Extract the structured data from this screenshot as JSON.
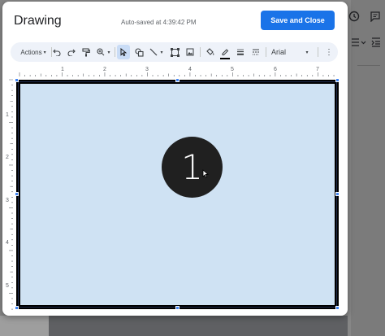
{
  "dialog": {
    "title": "Drawing",
    "autosave": "Auto-saved at 4:39:42 PM",
    "save_label": "Save and Close"
  },
  "toolbar": {
    "actions_label": "Actions",
    "actions_caret": "▾",
    "zoom_caret": "▾",
    "line_caret": "▾",
    "font_value": "Arial",
    "font_caret": "▾",
    "more_glyph": "⋮",
    "icons": [
      "undo-icon",
      "redo-icon",
      "paint-format-icon",
      "zoom-icon",
      "select-icon",
      "shape-icon",
      "line-icon",
      "textbox-icon",
      "image-icon",
      "fill-color-icon",
      "border-color-icon",
      "border-weight-icon",
      "border-dash-icon"
    ]
  },
  "ruler": {
    "top_labels": [
      "1",
      "2",
      "3",
      "4",
      "5",
      "6",
      "7"
    ],
    "left_labels": [
      "1",
      "2",
      "3",
      "4",
      "5"
    ]
  },
  "canvas": {
    "fill_color": "#cfe2f3",
    "border_color": "#000000",
    "circle_label": "1",
    "circle_color": "#202020"
  },
  "background": {
    "history_icon": "history-icon",
    "comment_icon": "comment-icon",
    "list_icon": "list-icon"
  }
}
